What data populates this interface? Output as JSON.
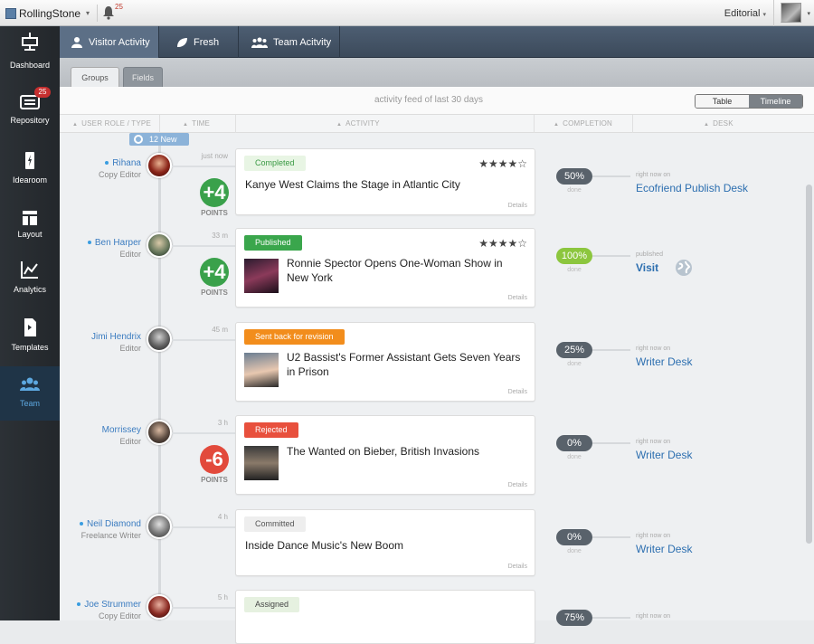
{
  "topbar": {
    "brand": "RollingStone",
    "notifications": "25",
    "editorial": "Editorial"
  },
  "sidebar": {
    "items": [
      {
        "label": "Dashboard",
        "icon": "dashboard-icon"
      },
      {
        "label": "Repository",
        "icon": "repository-icon",
        "badge": "25"
      },
      {
        "label": "Idearoom",
        "icon": "idearoom-icon"
      },
      {
        "label": "Layout",
        "icon": "layout-icon"
      },
      {
        "label": "Analytics",
        "icon": "analytics-icon"
      },
      {
        "label": "Templates",
        "icon": "templates-icon"
      },
      {
        "label": "Team",
        "icon": "team-icon",
        "active": true
      }
    ]
  },
  "tabs": [
    {
      "label": "Visitor Activity",
      "icon": "user-icon",
      "active": true
    },
    {
      "label": "Fresh",
      "icon": "leaf-icon"
    },
    {
      "label": "Team Acitvity",
      "icon": "team-icon"
    }
  ],
  "subtabs": {
    "groups": "Groups",
    "fields": "Fields"
  },
  "feed": {
    "title": "activity feed of last 30 days",
    "toggle_table": "Table",
    "toggle_timeline": "Timeline"
  },
  "columns": {
    "role": "USER ROLE / TYPE",
    "time": "TIME",
    "activity": "ACTIVITY",
    "completion": "COMPLETION",
    "desk": "DESK"
  },
  "new_badge": "12 New",
  "points_label": "POINTS",
  "details_label": "Details",
  "done_label": "done",
  "rows": [
    {
      "name": "Rihana",
      "role": "Copy Editor",
      "time": "just now",
      "points": "+4",
      "tag": "Completed",
      "title": "Kanye West Claims the Stage in Atlantic City",
      "rating": "4 of 5 stars",
      "completion": "50%",
      "desk_note": "right now on",
      "desk": "Ecofriend Publish Desk"
    },
    {
      "name": "Ben Harper",
      "role": "Editor",
      "time": "33 m",
      "points": "+4",
      "tag": "Published",
      "title": "Ronnie Spector Opens One-Woman Show in New York",
      "rating": "4 of 5 stars",
      "completion": "100%",
      "desk_note": "published",
      "desk": "Visit"
    },
    {
      "name": "Jimi Hendrix",
      "role": "Editor",
      "time": "45 m",
      "tag": "Sent back for revision",
      "title": "U2 Bassist's Former Assistant Gets Seven Years in Prison",
      "completion": "25%",
      "desk_note": "right now on",
      "desk": "Writer Desk"
    },
    {
      "name": "Morrissey",
      "role": "Editor",
      "time": "3 h",
      "points": "-6",
      "tag": "Rejected",
      "title": "The Wanted on Bieber, British Invasions",
      "completion": "0%",
      "desk_note": "right now on",
      "desk": "Writer Desk"
    },
    {
      "name": "Neil Diamond",
      "role": "Freelance Writer",
      "time": "4 h",
      "tag": "Committed",
      "title": "Inside Dance Music's New Boom",
      "completion": "0%",
      "desk_note": "right now on",
      "desk": "Writer Desk"
    },
    {
      "name": "Joe Strummer",
      "role": "Copy Editor",
      "time": "5 h",
      "tag": "Assigned",
      "title": "",
      "completion": "75%",
      "desk_note": "right now on",
      "desk": ""
    }
  ],
  "colors": {
    "accent": "#3b7cc0",
    "green": "#3aa64c",
    "orange": "#f28d1c",
    "red": "#e8503d",
    "sidebar": "#2c3136",
    "tabbar": "#4d5e72"
  }
}
